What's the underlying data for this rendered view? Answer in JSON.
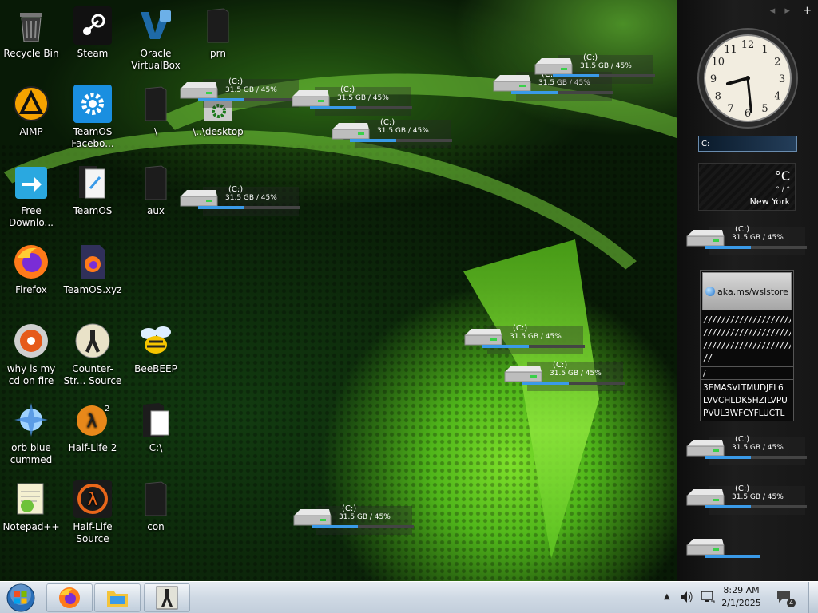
{
  "desktop_icons": [
    {
      "id": "recycle",
      "label": "Recycle Bin",
      "icon": "recycle-bin-icon"
    },
    {
      "id": "steam",
      "label": "Steam",
      "icon": "steam-icon"
    },
    {
      "id": "virtualbox",
      "label": "Oracle VirtualBox",
      "icon": "virtualbox-icon"
    },
    {
      "id": "prn",
      "label": "prn",
      "icon": "folder-icon"
    },
    {
      "id": "aimp",
      "label": "AIMP",
      "icon": "aimp-icon"
    },
    {
      "id": "teamos_fb",
      "label": "TeamOS Facebo...",
      "icon": "gear-icon"
    },
    {
      "id": "backslash",
      "label": "\\",
      "icon": "folder-icon"
    },
    {
      "id": "desktop_link",
      "label": "\\..\\desktop",
      "icon": "settings-shortcut-icon"
    },
    {
      "id": "fdm",
      "label": "Free Downlo...",
      "icon": "download-icon"
    },
    {
      "id": "teamos",
      "label": "TeamOS",
      "icon": "document-icon"
    },
    {
      "id": "aux",
      "label": "aux",
      "icon": "folder-icon"
    },
    {
      "id": "firefox",
      "label": "Firefox",
      "icon": "firefox-icon"
    },
    {
      "id": "teamos_xyz",
      "label": "TeamOS.xyz",
      "icon": "firefox-file-icon"
    },
    {
      "id": "cdfire",
      "label": "why is my cd on fire",
      "icon": "cd-fire-icon"
    },
    {
      "id": "css",
      "label": "Counter-Str... Source",
      "icon": "counter-strike-icon"
    },
    {
      "id": "beebeep",
      "label": "BeeBEEP",
      "icon": "bee-icon"
    },
    {
      "id": "orb",
      "label": "orb blue cummed",
      "icon": "orb-icon"
    },
    {
      "id": "hl2",
      "label": "Half-Life 2",
      "icon": "half-life-2-icon"
    },
    {
      "id": "cdrive",
      "label": "C:\\",
      "icon": "drive-shortcut-icon"
    },
    {
      "id": "notepad",
      "label": "Notepad++",
      "icon": "notepad-plus-icon"
    },
    {
      "id": "hls",
      "label": "Half-Life Source",
      "icon": "half-life-icon"
    },
    {
      "id": "con",
      "label": "con",
      "icon": "folder-icon"
    }
  ],
  "drive_meter": {
    "drive": "(C:)",
    "info": "31.5 GB / 45%",
    "used_percent": 45
  },
  "sidebar": {
    "nav": {
      "prev": "◂",
      "next": "▸",
      "add": "+"
    },
    "clock": {
      "hour": 8,
      "minute": 29
    },
    "search_value": "C:",
    "weather": {
      "temp": "°C",
      "range": "° / °",
      "city": "New York"
    },
    "wsl_button": "aka.ms/wslstore",
    "text_lines": [
      "////////////////////////////",
      "////////////////////////////",
      "////////////////////////////",
      "//"
    ],
    "slash_line": "/",
    "code_lines": [
      "3EMASVLTMUDJFL6",
      "LVVCHLDK5HZILVPU",
      "PVUL3WFCYFLUCTL"
    ]
  },
  "taskbar": {
    "time": "8:29 AM",
    "date": "2/1/2025",
    "notifications": "4",
    "show_hidden": "▲"
  }
}
